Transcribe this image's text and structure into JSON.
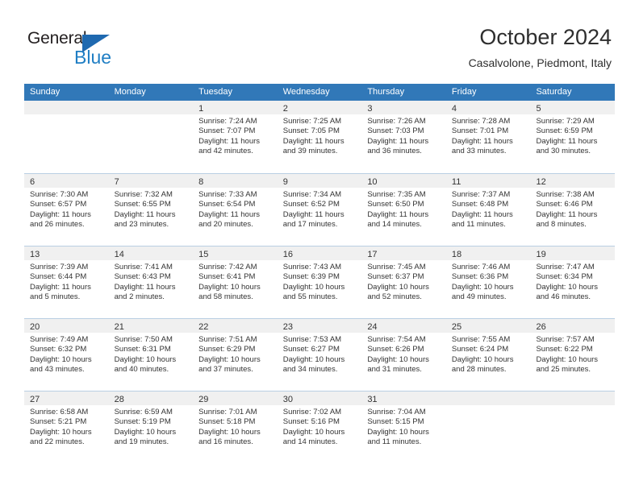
{
  "brand": {
    "name_top": "General",
    "name_bottom": "Blue",
    "accent_color": "#1f7ec4",
    "triangle_color": "#1f69b0"
  },
  "header": {
    "title": "October 2024",
    "subtitle": "Casalvolone, Piedmont, Italy"
  },
  "calendar": {
    "header_bg": "#3178b8",
    "header_text_color": "#ffffff",
    "daynum_band_bg": "#f0f0f0",
    "grid_line_color": "#b9cfe3",
    "weekdays": [
      "Sunday",
      "Monday",
      "Tuesday",
      "Wednesday",
      "Thursday",
      "Friday",
      "Saturday"
    ],
    "weeks": [
      [
        {
          "day": "",
          "lines": []
        },
        {
          "day": "",
          "lines": []
        },
        {
          "day": "1",
          "lines": [
            "Sunrise: 7:24 AM",
            "Sunset: 7:07 PM",
            "Daylight: 11 hours",
            "and 42 minutes."
          ]
        },
        {
          "day": "2",
          "lines": [
            "Sunrise: 7:25 AM",
            "Sunset: 7:05 PM",
            "Daylight: 11 hours",
            "and 39 minutes."
          ]
        },
        {
          "day": "3",
          "lines": [
            "Sunrise: 7:26 AM",
            "Sunset: 7:03 PM",
            "Daylight: 11 hours",
            "and 36 minutes."
          ]
        },
        {
          "day": "4",
          "lines": [
            "Sunrise: 7:28 AM",
            "Sunset: 7:01 PM",
            "Daylight: 11 hours",
            "and 33 minutes."
          ]
        },
        {
          "day": "5",
          "lines": [
            "Sunrise: 7:29 AM",
            "Sunset: 6:59 PM",
            "Daylight: 11 hours",
            "and 30 minutes."
          ]
        }
      ],
      [
        {
          "day": "6",
          "lines": [
            "Sunrise: 7:30 AM",
            "Sunset: 6:57 PM",
            "Daylight: 11 hours",
            "and 26 minutes."
          ]
        },
        {
          "day": "7",
          "lines": [
            "Sunrise: 7:32 AM",
            "Sunset: 6:55 PM",
            "Daylight: 11 hours",
            "and 23 minutes."
          ]
        },
        {
          "day": "8",
          "lines": [
            "Sunrise: 7:33 AM",
            "Sunset: 6:54 PM",
            "Daylight: 11 hours",
            "and 20 minutes."
          ]
        },
        {
          "day": "9",
          "lines": [
            "Sunrise: 7:34 AM",
            "Sunset: 6:52 PM",
            "Daylight: 11 hours",
            "and 17 minutes."
          ]
        },
        {
          "day": "10",
          "lines": [
            "Sunrise: 7:35 AM",
            "Sunset: 6:50 PM",
            "Daylight: 11 hours",
            "and 14 minutes."
          ]
        },
        {
          "day": "11",
          "lines": [
            "Sunrise: 7:37 AM",
            "Sunset: 6:48 PM",
            "Daylight: 11 hours",
            "and 11 minutes."
          ]
        },
        {
          "day": "12",
          "lines": [
            "Sunrise: 7:38 AM",
            "Sunset: 6:46 PM",
            "Daylight: 11 hours",
            "and 8 minutes."
          ]
        }
      ],
      [
        {
          "day": "13",
          "lines": [
            "Sunrise: 7:39 AM",
            "Sunset: 6:44 PM",
            "Daylight: 11 hours",
            "and 5 minutes."
          ]
        },
        {
          "day": "14",
          "lines": [
            "Sunrise: 7:41 AM",
            "Sunset: 6:43 PM",
            "Daylight: 11 hours",
            "and 2 minutes."
          ]
        },
        {
          "day": "15",
          "lines": [
            "Sunrise: 7:42 AM",
            "Sunset: 6:41 PM",
            "Daylight: 10 hours",
            "and 58 minutes."
          ]
        },
        {
          "day": "16",
          "lines": [
            "Sunrise: 7:43 AM",
            "Sunset: 6:39 PM",
            "Daylight: 10 hours",
            "and 55 minutes."
          ]
        },
        {
          "day": "17",
          "lines": [
            "Sunrise: 7:45 AM",
            "Sunset: 6:37 PM",
            "Daylight: 10 hours",
            "and 52 minutes."
          ]
        },
        {
          "day": "18",
          "lines": [
            "Sunrise: 7:46 AM",
            "Sunset: 6:36 PM",
            "Daylight: 10 hours",
            "and 49 minutes."
          ]
        },
        {
          "day": "19",
          "lines": [
            "Sunrise: 7:47 AM",
            "Sunset: 6:34 PM",
            "Daylight: 10 hours",
            "and 46 minutes."
          ]
        }
      ],
      [
        {
          "day": "20",
          "lines": [
            "Sunrise: 7:49 AM",
            "Sunset: 6:32 PM",
            "Daylight: 10 hours",
            "and 43 minutes."
          ]
        },
        {
          "day": "21",
          "lines": [
            "Sunrise: 7:50 AM",
            "Sunset: 6:31 PM",
            "Daylight: 10 hours",
            "and 40 minutes."
          ]
        },
        {
          "day": "22",
          "lines": [
            "Sunrise: 7:51 AM",
            "Sunset: 6:29 PM",
            "Daylight: 10 hours",
            "and 37 minutes."
          ]
        },
        {
          "day": "23",
          "lines": [
            "Sunrise: 7:53 AM",
            "Sunset: 6:27 PM",
            "Daylight: 10 hours",
            "and 34 minutes."
          ]
        },
        {
          "day": "24",
          "lines": [
            "Sunrise: 7:54 AM",
            "Sunset: 6:26 PM",
            "Daylight: 10 hours",
            "and 31 minutes."
          ]
        },
        {
          "day": "25",
          "lines": [
            "Sunrise: 7:55 AM",
            "Sunset: 6:24 PM",
            "Daylight: 10 hours",
            "and 28 minutes."
          ]
        },
        {
          "day": "26",
          "lines": [
            "Sunrise: 7:57 AM",
            "Sunset: 6:22 PM",
            "Daylight: 10 hours",
            "and 25 minutes."
          ]
        }
      ],
      [
        {
          "day": "27",
          "lines": [
            "Sunrise: 6:58 AM",
            "Sunset: 5:21 PM",
            "Daylight: 10 hours",
            "and 22 minutes."
          ]
        },
        {
          "day": "28",
          "lines": [
            "Sunrise: 6:59 AM",
            "Sunset: 5:19 PM",
            "Daylight: 10 hours",
            "and 19 minutes."
          ]
        },
        {
          "day": "29",
          "lines": [
            "Sunrise: 7:01 AM",
            "Sunset: 5:18 PM",
            "Daylight: 10 hours",
            "and 16 minutes."
          ]
        },
        {
          "day": "30",
          "lines": [
            "Sunrise: 7:02 AM",
            "Sunset: 5:16 PM",
            "Daylight: 10 hours",
            "and 14 minutes."
          ]
        },
        {
          "day": "31",
          "lines": [
            "Sunrise: 7:04 AM",
            "Sunset: 5:15 PM",
            "Daylight: 10 hours",
            "and 11 minutes."
          ]
        },
        {
          "day": "",
          "lines": []
        },
        {
          "day": "",
          "lines": []
        }
      ]
    ]
  }
}
